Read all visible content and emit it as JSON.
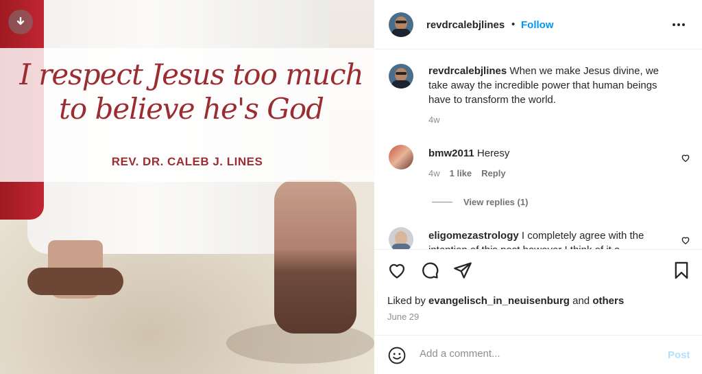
{
  "media": {
    "quote_line1": "I respect Jesus too much",
    "quote_line2": "to believe he's God",
    "author": "REV. DR. CALEB J. LINES",
    "download_icon": "download-arrow-icon"
  },
  "header": {
    "username": "revdrcalebjlines",
    "separator": "•",
    "follow_label": "Follow",
    "more_icon": "more-options-icon"
  },
  "caption": {
    "username": "revdrcalebjlines",
    "text": "When we make Jesus divine, we take away the incredible power that human beings have to transform the world.",
    "age": "4w"
  },
  "comments": [
    {
      "username": "bmw2011",
      "text": "Heresy",
      "age": "4w",
      "likes": "1 like",
      "reply_label": "Reply",
      "view_replies": "View replies (1)"
    },
    {
      "username": "eligomezastrology",
      "text": "I completely agree with the intention of this post however I think of it a"
    }
  ],
  "actions": {
    "like_icon": "heart-icon",
    "comment_icon": "comment-icon",
    "share_icon": "share-icon",
    "save_icon": "bookmark-icon"
  },
  "likes": {
    "prefix": "Liked by",
    "liker": "evangelisch_in_neuisenburg",
    "joiner": "and",
    "others": "others"
  },
  "date": "June 29",
  "add_comment": {
    "placeholder": "Add a comment...",
    "post_label": "Post"
  },
  "colors": {
    "accent": "#0095f6",
    "post_disabled": "#b2dffc",
    "quote": "#9b2c32"
  }
}
